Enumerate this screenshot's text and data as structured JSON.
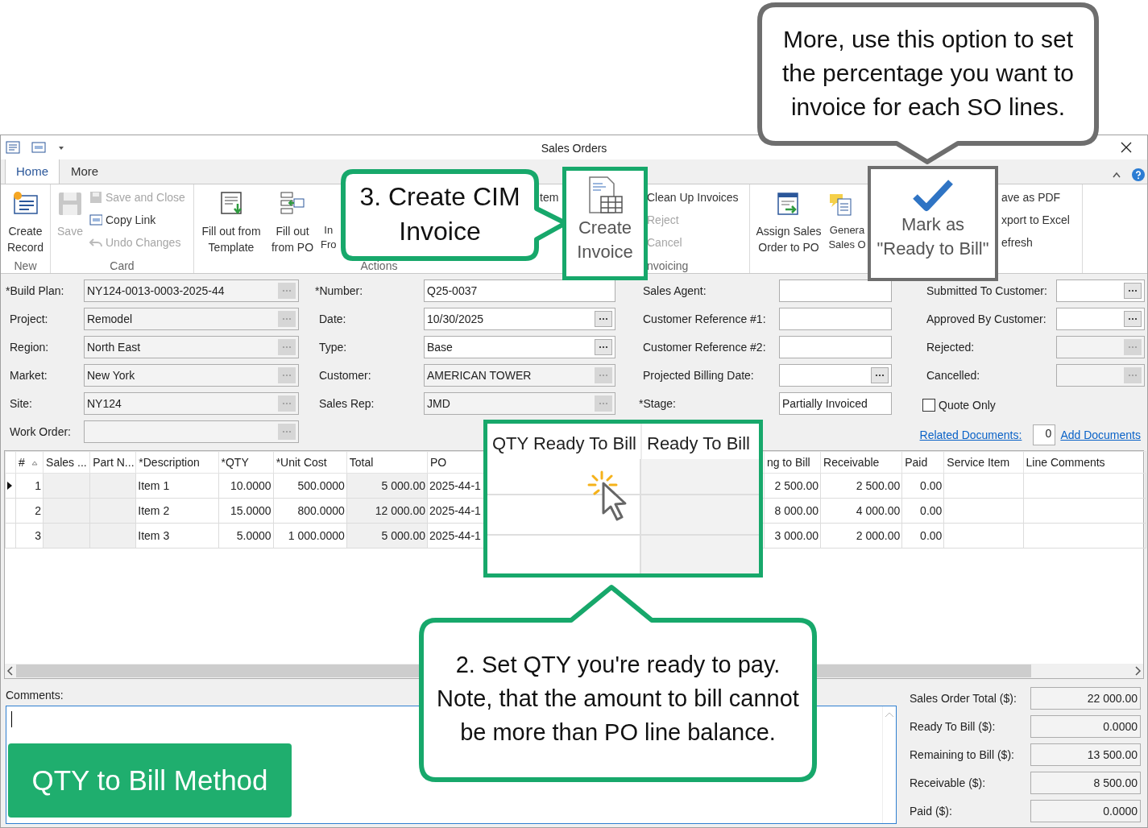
{
  "window": {
    "title": "Sales Orders"
  },
  "tabs": [
    {
      "label": "Home",
      "selected": true
    },
    {
      "label": "More",
      "selected": false
    }
  ],
  "ribbon": {
    "groups": [
      {
        "label": "New",
        "items": [
          {
            "kind": "large",
            "label": "Create Record",
            "disabled": false
          }
        ]
      },
      {
        "label": "Card",
        "items": [
          {
            "kind": "large",
            "label": "Save",
            "disabled": true
          },
          {
            "kind": "small",
            "label": "Save and Close",
            "disabled": true
          },
          {
            "kind": "small",
            "label": "Copy Link",
            "disabled": false
          },
          {
            "kind": "small",
            "label": "Undo Changes",
            "disabled": true
          }
        ]
      },
      {
        "label": "Actions",
        "items": [
          {
            "kind": "large",
            "label": "Fill out from Template",
            "disabled": false
          },
          {
            "kind": "large",
            "label": "Fill out from PO",
            "disabled": false
          },
          {
            "kind": "cut",
            "label": "In Fro",
            "disabled": false
          },
          {
            "kind": "small",
            "label": "tem",
            "disabled": false
          }
        ]
      },
      {
        "label": "nvoicing",
        "items": [
          {
            "kind": "small",
            "label": "Clean Up Invoices",
            "disabled": false
          },
          {
            "kind": "small",
            "label": "Reject",
            "disabled": true
          },
          {
            "kind": "small",
            "label": "Cancel",
            "disabled": true
          }
        ]
      },
      {
        "items": [
          {
            "kind": "large",
            "label": "Assign Sales Order to PO",
            "disabled": false
          },
          {
            "kind": "cut",
            "label": "Genera Sales O",
            "disabled": false
          }
        ]
      },
      {
        "items": [
          {
            "kind": "small",
            "label": "ave as PDF",
            "disabled": false
          },
          {
            "kind": "small",
            "label": "xport to Excel",
            "disabled": false
          },
          {
            "kind": "small",
            "label": "efresh",
            "disabled": false
          }
        ]
      }
    ]
  },
  "form": {
    "columns": [
      [
        {
          "label": "*Build Plan:",
          "value": "NY124-0013-0003-2025-44",
          "kind": "lookup",
          "disabled": true
        },
        {
          "label": "Project:",
          "value": "Remodel",
          "kind": "lookup",
          "disabled": true
        },
        {
          "label": "Region:",
          "value": "North East",
          "kind": "lookup",
          "disabled": true
        },
        {
          "label": "Market:",
          "value": "New York",
          "kind": "lookup",
          "disabled": true
        },
        {
          "label": "Site:",
          "value": "NY124",
          "kind": "lookup",
          "disabled": true
        },
        {
          "label": "Work Order:",
          "kind": "lookup",
          "disabled": true
        }
      ],
      [
        {
          "label": "*Number:",
          "value": "Q25-0037",
          "kind": "text",
          "disabled": false
        },
        {
          "label": "Date:",
          "value": "10/30/2025",
          "kind": "lookup",
          "disabled": false
        },
        {
          "label": "Type:",
          "value": "Base",
          "kind": "lookup",
          "disabled": false
        },
        {
          "label": "Customer:",
          "value": "AMERICAN TOWER",
          "kind": "lookup",
          "disabled": true
        },
        {
          "label": "Sales Rep:",
          "value": "JMD",
          "kind": "lookup",
          "disabled": true
        }
      ],
      [
        {
          "label": "Sales Agent:",
          "kind": "text",
          "disabled": false
        },
        {
          "label": "Customer Reference #1:",
          "kind": "text",
          "disabled": false
        },
        {
          "label": "Customer Reference #2:",
          "kind": "text",
          "disabled": false
        },
        {
          "label": "Projected Billing Date:",
          "kind": "lookup",
          "disabled": false
        },
        {
          "label": "*Stage:",
          "value": "Partially Invoiced",
          "kind": "text",
          "disabled": false
        }
      ],
      [
        {
          "label": "Submitted To Customer:",
          "kind": "lookup",
          "disabled": false
        },
        {
          "label": "Approved By Customer:",
          "kind": "lookup",
          "disabled": false
        },
        {
          "label": "Rejected:",
          "kind": "lookup",
          "disabled": true
        },
        {
          "label": "Cancelled:",
          "kind": "lookup",
          "disabled": true
        },
        {
          "label": "Quote Only",
          "kind": "checkbox",
          "checked": false
        }
      ]
    ],
    "documents": {
      "related_link": "Related Documents:",
      "count": "0",
      "add_link": "Add Documents"
    }
  },
  "grid": {
    "columns": [
      {
        "label": "#",
        "kind": "number",
        "readonly": false
      },
      {
        "label": "Sales ...",
        "kind": "text",
        "readonly": true
      },
      {
        "label": "Part N...",
        "kind": "text",
        "readonly": true
      },
      {
        "label": "*Description",
        "kind": "text",
        "readonly": false
      },
      {
        "label": "*QTY",
        "kind": "number",
        "readonly": false
      },
      {
        "label": "*Unit Cost",
        "kind": "number",
        "readonly": false
      },
      {
        "label": "Total",
        "kind": "number",
        "readonly": true
      },
      {
        "label": "PO",
        "kind": "text",
        "readonly": false
      },
      {
        "label": "ng to Bill",
        "kind": "number",
        "readonly": false
      },
      {
        "label": "Receivable",
        "kind": "number",
        "readonly": false
      },
      {
        "label": "Paid",
        "kind": "number",
        "readonly": false
      },
      {
        "label": "Service Item",
        "kind": "text",
        "readonly": false
      },
      {
        "label": "Line Comments",
        "kind": "text",
        "readonly": false
      }
    ],
    "rows": [
      {
        "selected": true,
        "cells": [
          "1",
          null,
          null,
          "Item 1",
          "10.0000",
          "500.0000",
          "5 000.00",
          "2025-44-1",
          "2 500.00",
          "2 500.00",
          "0.00",
          null,
          null
        ]
      },
      {
        "selected": false,
        "cells": [
          "2",
          null,
          null,
          "Item 2",
          "15.0000",
          "800.0000",
          "12 000.00",
          "2025-44-1",
          "8 000.00",
          "4 000.00",
          "0.00",
          null,
          null
        ]
      },
      {
        "selected": false,
        "cells": [
          "3",
          null,
          null,
          "Item 3",
          "5.0000",
          "1 000.0000",
          "5 000.00",
          "2025-44-1",
          "3 000.00",
          "2 000.00",
          "0.00",
          null,
          null
        ]
      }
    ]
  },
  "comments": {
    "label": "Comments:"
  },
  "totals": [
    {
      "label": "Sales Order Total ($):",
      "value": "22 000.00"
    },
    {
      "label": "Ready To Bill ($):",
      "value": "0.0000"
    },
    {
      "label": "Remaining to Bill ($):",
      "value": "13 500.00"
    },
    {
      "label": "Receivable ($):",
      "value": "8 500.00"
    },
    {
      "label": "Paid ($):",
      "value": "0.0000"
    }
  ],
  "annotations": {
    "top_note": "More, use this option to set the percentage you want to invoice for each SO lines.",
    "step3_note": "3. Create CIM Invoice",
    "create_invoice_zoom": "Create Invoice",
    "ready_zoom": "Mark as \"Ready to Bill\"",
    "qty_zoom_columns": [
      "QTY Ready To Bill",
      "Ready To Bill"
    ],
    "step2_note": "2. Set QTY you're ready to pay. Note, that the amount to bill cannot be more than PO line balance.",
    "method_label": "QTY to Bill Method"
  }
}
